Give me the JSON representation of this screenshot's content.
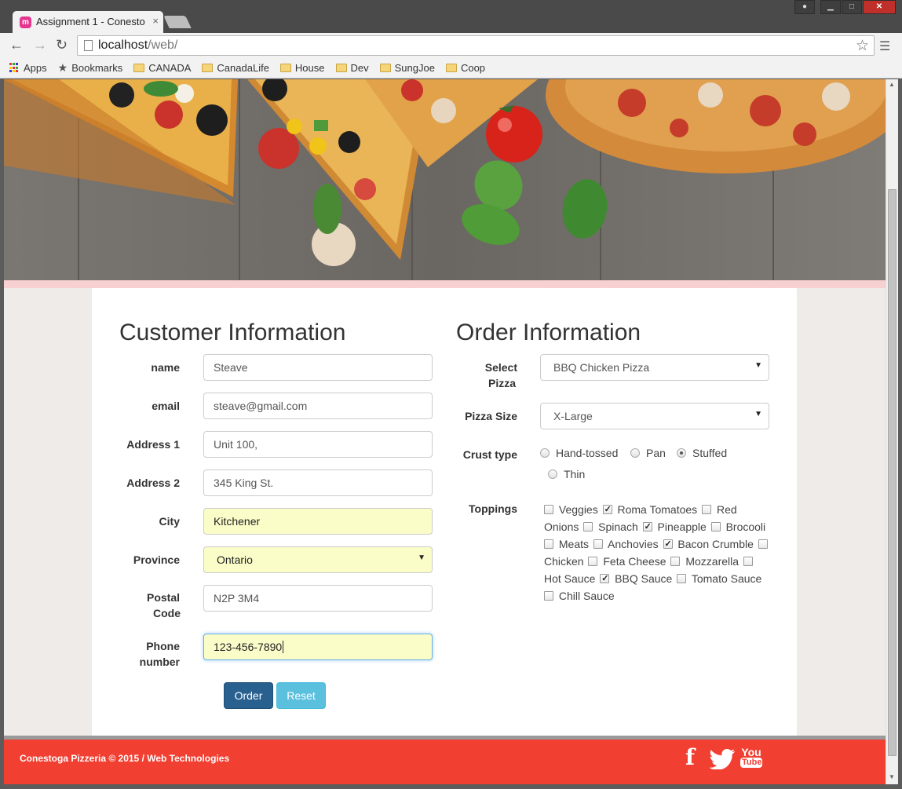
{
  "browser": {
    "tab_title": "Assignment 1 - Conesto",
    "url_host": "localhost",
    "url_path": "/web/",
    "bookmarks": [
      "Apps",
      "Bookmarks",
      "CANADA",
      "CanadaLife",
      "House",
      "Dev",
      "SungJoe",
      "Coop"
    ]
  },
  "customer": {
    "title": "Customer Information",
    "fields": {
      "name": {
        "label": "name",
        "value": "Steave"
      },
      "email": {
        "label": "email",
        "value": "steave@gmail.com"
      },
      "address1": {
        "label": "Address 1",
        "value": "Unit 100,"
      },
      "address2": {
        "label": "Address 2",
        "value": "345 King St."
      },
      "city": {
        "label": "City",
        "value": "Kitchener"
      },
      "province": {
        "label": "Province",
        "value": "Ontario"
      },
      "postal_label_1": "Postal",
      "postal_label_2": "Code",
      "postal": {
        "value": "N2P 3M4"
      },
      "phone_label_1": "Phone",
      "phone_label_2": "number",
      "phone": {
        "value": "123-456-7890"
      }
    }
  },
  "order": {
    "title": "Order Information",
    "select_pizza_label_1": "Select",
    "select_pizza_label_2": "Pizza",
    "select_pizza_value": "BBQ Chicken Pizza",
    "size_label": "Pizza Size",
    "size_value": "X-Large",
    "crust_label": "Crust type",
    "crust_options": [
      {
        "label": "Hand-tossed",
        "checked": false
      },
      {
        "label": "Pan",
        "checked": false
      },
      {
        "label": "Stuffed",
        "checked": true
      },
      {
        "label": "Thin",
        "checked": false
      }
    ],
    "toppings_label": "Toppings",
    "toppings": [
      {
        "label": "Veggies",
        "checked": false
      },
      {
        "label": "Roma Tomatoes",
        "checked": true
      },
      {
        "label": "Red Onions",
        "checked": false
      },
      {
        "label": "Spinach",
        "checked": false
      },
      {
        "label": "Pineapple",
        "checked": true
      },
      {
        "label": "Brocooli",
        "checked": false
      },
      {
        "label": "Meats",
        "checked": false
      },
      {
        "label": "Anchovies",
        "checked": false
      },
      {
        "label": "Bacon Crumble",
        "checked": true
      },
      {
        "label": "Chicken",
        "checked": false
      },
      {
        "label": "Feta Cheese",
        "checked": false
      },
      {
        "label": "Mozzarella",
        "checked": false
      },
      {
        "label": "Hot Sauce",
        "checked": false
      },
      {
        "label": "BBQ Sauce",
        "checked": true
      },
      {
        "label": "Tomato Sauce",
        "checked": false
      },
      {
        "label": "Chill Sauce",
        "checked": false
      }
    ]
  },
  "buttons": {
    "order": "Order",
    "reset": "Reset"
  },
  "footer": {
    "text": "Conestoga Pizzeria © 2015 / Web Technologies"
  },
  "colors": {
    "footer": "#f13f32",
    "order_button": "#286090",
    "reset_button": "#5bc0de",
    "highlight_field": "#fbfdc9"
  }
}
